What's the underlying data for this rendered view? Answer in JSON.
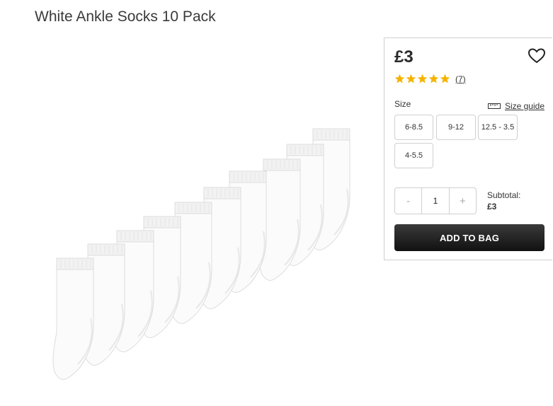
{
  "product": {
    "title": "White Ankle Socks 10 Pack",
    "image_alt": "socks-product-image"
  },
  "panel": {
    "price": "£3",
    "rating": {
      "stars": 5,
      "count_label": "(7)"
    },
    "size_label": "Size",
    "size_guide_label": "Size guide",
    "sizes": [
      "6-8.5",
      "9-12",
      "12.5 - 3.5",
      "4-5.5"
    ],
    "quantity": {
      "minus": "-",
      "value": "1",
      "plus": "+"
    },
    "subtotal_label": "Subtotal:",
    "subtotal_value": "£3",
    "add_to_bag_label": "ADD TO BAG"
  },
  "colors": {
    "star": "#f5b301",
    "button": "#1a1a1a"
  }
}
